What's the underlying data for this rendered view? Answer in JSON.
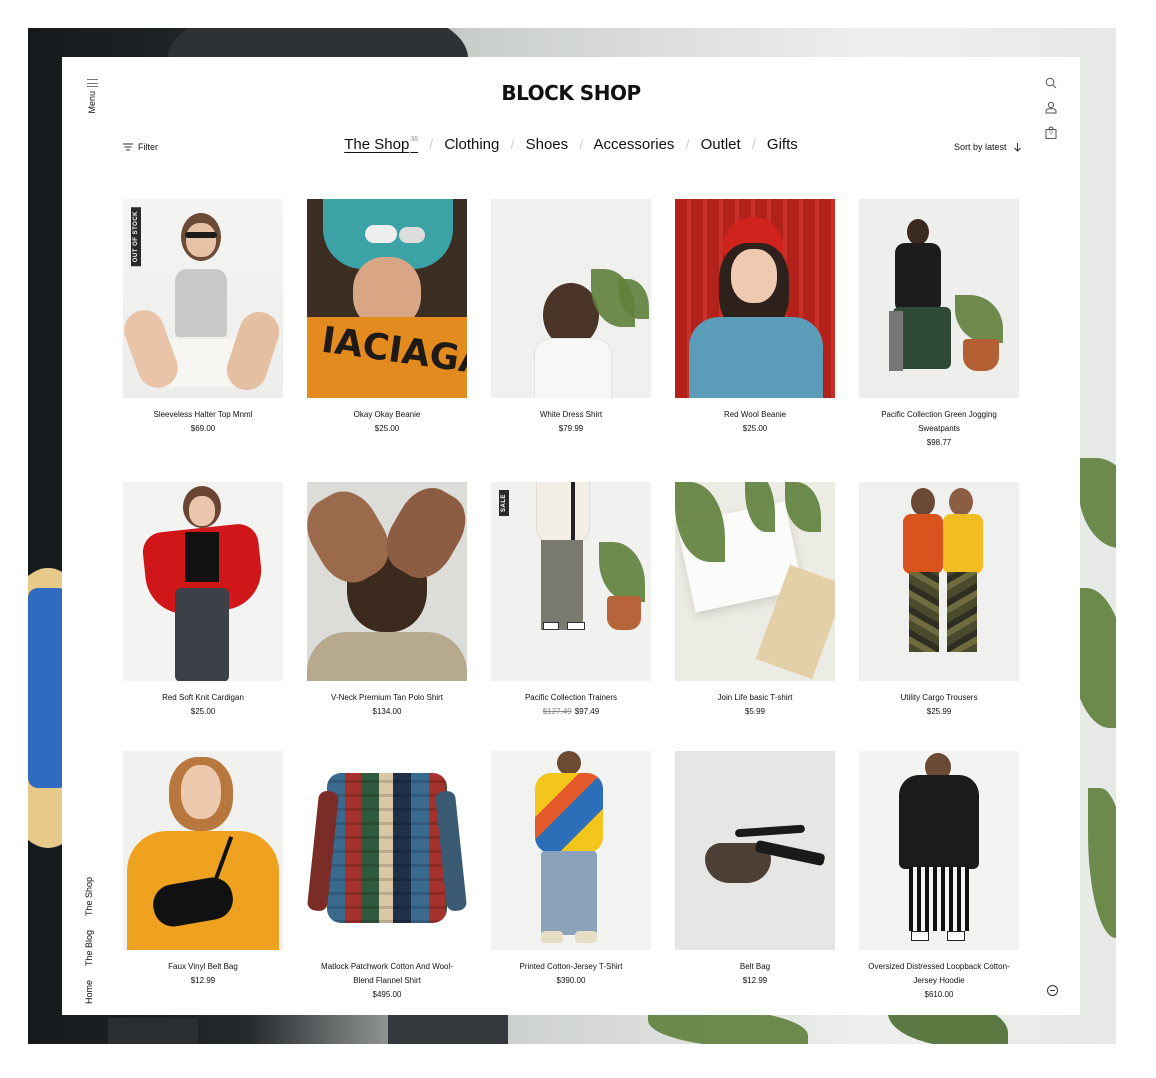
{
  "header": {
    "menu_label": "Menu",
    "logo": "BLOCK SHOP"
  },
  "toolbar": {
    "filter_label": "Filter",
    "sort_label": "Sort by latest",
    "cart_count": "0"
  },
  "categories": {
    "items": [
      {
        "label": "The Shop",
        "count": "36"
      },
      {
        "label": "Clothing"
      },
      {
        "label": "Shoes"
      },
      {
        "label": "Accessories"
      },
      {
        "label": "Outlet"
      },
      {
        "label": "Gifts"
      }
    ]
  },
  "products": [
    {
      "name": "Sleeveless Halter Top Mnml",
      "price": "$69.00",
      "badge": "OUT OF STOCK"
    },
    {
      "name": "Okay Okay Beanie",
      "price": "$25.00"
    },
    {
      "name": "White Dress Shirt",
      "price": "$79.99"
    },
    {
      "name": "Red Wool Beanie",
      "price": "$25.00"
    },
    {
      "name": "Pacific Collection Green Jogging Sweatpants",
      "price": "$98.77"
    },
    {
      "name": "Red Soft Knit Cardigan",
      "price": "$25.00"
    },
    {
      "name": "V-Neck Premium Tan Polo Shirt",
      "price": "$134.00"
    },
    {
      "name": "Pacific Collection Trainers",
      "old_price": "$127.49",
      "price": "$97.49",
      "badge": "SALE"
    },
    {
      "name": "Join Life basic T-shirt",
      "price": "$5.99"
    },
    {
      "name": "Utility Cargo Trousers",
      "price": "$25.99"
    },
    {
      "name": "Faux Vinyl Belt Bag",
      "price": "$12.99"
    },
    {
      "name": "Matlock Patchwork Cotton And Wool-Blend Flannel Shirt",
      "price": "$495.00"
    },
    {
      "name": "Printed Cotton-Jersey T-Shirt",
      "price": "$390.00"
    },
    {
      "name": "Belt Bag",
      "price": "$12.99"
    },
    {
      "name": "Oversized Distressed Loopback Cotton-Jersey Hoodie",
      "price": "$610.00"
    }
  ],
  "side_links": {
    "home": "Home",
    "blog": "The Blog",
    "shop": "The Shop"
  },
  "colors": {
    "accent": "#111111",
    "badge": "#2a2a2a"
  }
}
